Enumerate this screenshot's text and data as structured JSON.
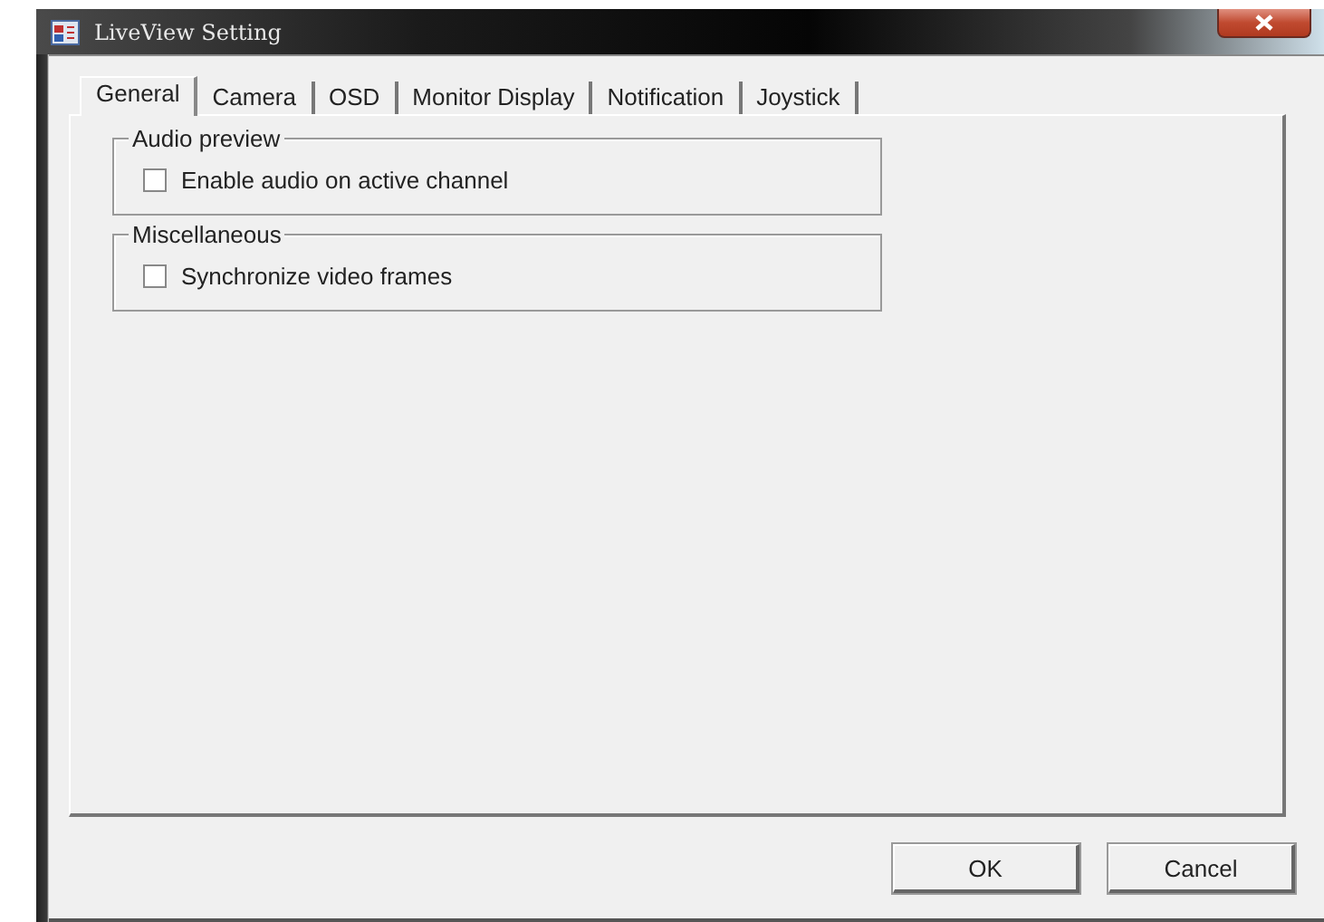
{
  "window": {
    "title": "LiveView Setting"
  },
  "tabs": [
    {
      "label": "General",
      "selected": true
    },
    {
      "label": "Camera",
      "selected": false
    },
    {
      "label": "OSD",
      "selected": false
    },
    {
      "label": "Monitor Display",
      "selected": false
    },
    {
      "label": "Notification",
      "selected": false
    },
    {
      "label": "Joystick",
      "selected": false
    }
  ],
  "groups": [
    {
      "title": "Audio preview",
      "options": [
        {
          "label": "Enable audio on active channel",
          "checked": false
        }
      ]
    },
    {
      "title": "Miscellaneous",
      "options": [
        {
          "label": "Synchronize video frames",
          "checked": false
        }
      ]
    }
  ],
  "buttons": [
    "OK",
    "Cancel"
  ]
}
